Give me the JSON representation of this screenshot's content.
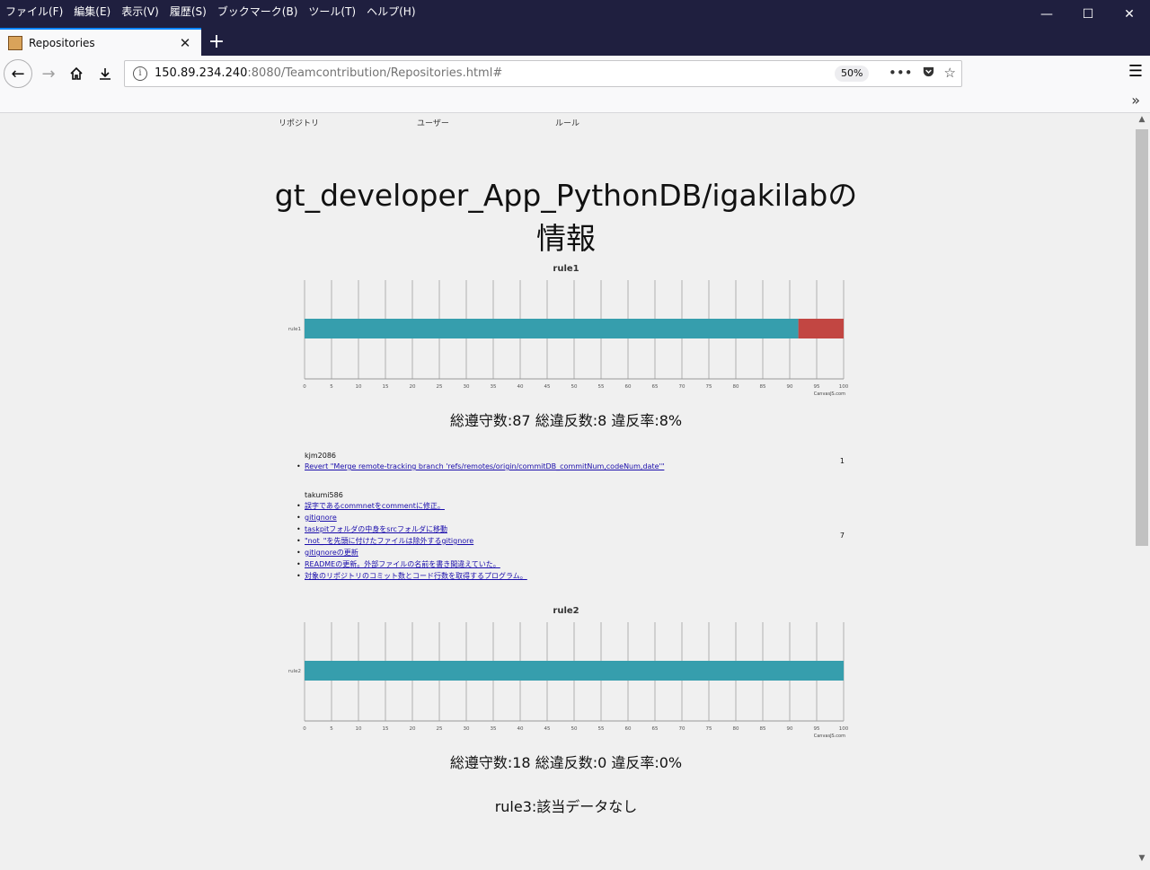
{
  "menubar": {
    "items": [
      "ファイル(F)",
      "編集(E)",
      "表示(V)",
      "履歴(S)",
      "ブックマーク(B)",
      "ツール(T)",
      "ヘルプ(H)"
    ]
  },
  "tab": {
    "title": "Repositories"
  },
  "address": {
    "host": "150.89.234.240",
    "rest": ":8080/Teamcontribution/Repositories.html#",
    "zoom": "50%"
  },
  "page": {
    "nav": [
      "リポジトリ",
      "ユーザー",
      "ルール"
    ],
    "title": "gt_developer_App_PythonDB/igakilabの情報",
    "rule3_text": "rule3:該当データなし"
  },
  "chart_data": [
    {
      "type": "bar",
      "title": "rule1",
      "categories": [
        "rule1"
      ],
      "series": [
        {
          "values": [
            91.6
          ],
          "color": "#369ead"
        },
        {
          "values": [
            8.4
          ],
          "color": "#c24642"
        }
      ],
      "xlim": [
        0,
        100
      ],
      "ticks": [
        0,
        5,
        10,
        15,
        20,
        25,
        30,
        35,
        40,
        45,
        50,
        55,
        60,
        65,
        70,
        75,
        80,
        85,
        90,
        95,
        100
      ],
      "credit": "CanvasJS.com",
      "summary": "総遵守数:87 総違反数:8 違反率:8%"
    },
    {
      "type": "bar",
      "title": "rule2",
      "categories": [
        "rule2"
      ],
      "series": [
        {
          "values": [
            100
          ],
          "color": "#369ead"
        }
      ],
      "xlim": [
        0,
        100
      ],
      "ticks": [
        0,
        5,
        10,
        15,
        20,
        25,
        30,
        35,
        40,
        45,
        50,
        55,
        60,
        65,
        70,
        75,
        80,
        85,
        90,
        95,
        100
      ],
      "credit": "CanvasJS.com",
      "summary": "総遵守数:18 総違反数:0 違反率:0%"
    }
  ],
  "violations": [
    {
      "author": "kjm2086",
      "count": "1",
      "commits": [
        "Revert \"Merge remote-tracking branch 'refs/remotes/origin/commitDB_commitNum,codeNum,date'\""
      ]
    },
    {
      "author": "takumi586",
      "count": "7",
      "commits": [
        "誤字であるcommnetをcommentに修正。",
        "gitignore",
        "taskpitフォルダの中身をsrcフォルダに移動",
        "\"not_\"を先頭に付けたファイルは除外するgitignore",
        "gitignoreの更新",
        "READMEの更新。外部ファイルの名前を書き間違えていた。",
        "対象のリポジトリのコミット数とコード行数を取得するプログラム。"
      ]
    }
  ]
}
